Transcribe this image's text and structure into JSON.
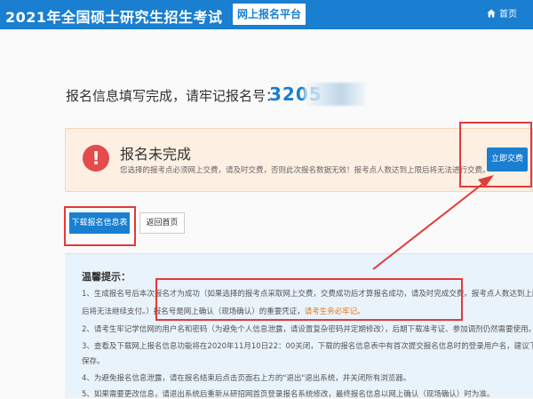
{
  "header": {
    "site_title": "2021年全国硕士研究生招生考试",
    "platform_label": "网上报名平台",
    "home_label": "首页"
  },
  "registration": {
    "title": "报名信息填写完成，请牢记报名号：",
    "number_visible": "3205"
  },
  "warning": {
    "title": "报名未完成",
    "description": "您选择的报考点必须网上交费，请及时交费，否则此次报名数据无效！报考点人数达到上限后将无法进行交费。",
    "pay_button": "立即交费"
  },
  "actions": {
    "download_button": "下载报名信息表",
    "back_button": "返回首页"
  },
  "tips": {
    "title": "温馨提示：",
    "line1_prefix": "1、生成报名号后本次报名才为成功（如果选择的报考点采取网上交费，交费成功后才算报名成功，请及时完成交费。报考点人数达到上限",
    "line1_cont": "后将无法继续支付。）报名号是网上确认（现场确认）的重要凭证，",
    "line1_note": "请考生务必牢记。",
    "line2": "2、请考生牢记学信网的用户名和密码（为避免个人信息泄露，请设置复杂密码并定期修改），后期下载准考证、参加调剂仍然需要使用。",
    "line3": "3、查看及下载网上报名信息功能将在2020年11月10日22：00关闭，下载的报名信息表中有首次提交报名信息时的登录用户名，建议下载",
    "line3_cont": "保存。",
    "line4": "4、为避免报名信息泄露，请在报名结束后点击页面右上方的\"退出\"退出系统，并关闭所有浏览器。",
    "line5": "5、如果需要更改信息，请退出系统后重新从研招网首页登录报名系统修改，最终报名信息以网上确认（现场确认）时为准。"
  },
  "colors": {
    "brand": "#1a7fd0",
    "annotation": "#e23a3a",
    "warning_bg": "#fdefe2",
    "tips_bg": "#e9f3fb"
  }
}
